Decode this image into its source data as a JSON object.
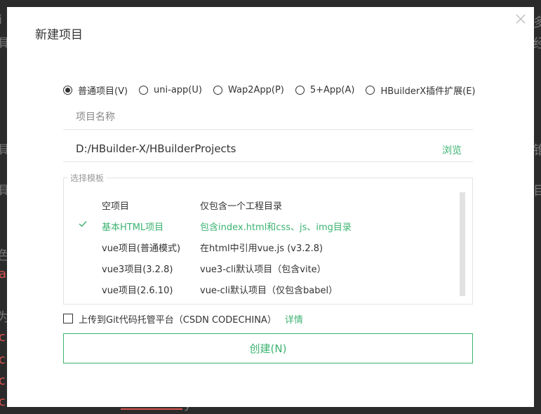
{
  "background": {
    "glyphs_white": [
      "i",
      "具",
      "具",
      "具",
      "色",
      "为"
    ],
    "glyphs_red": [
      "a",
      "c",
      "c",
      "c",
      "c"
    ],
    "right_glyphs": [
      "多",
      "经",
      "锥",
      "目"
    ],
    "bottom_glyph": "y"
  },
  "dialog": {
    "title": "新建项目",
    "close_icon": "close-icon"
  },
  "project_types": [
    {
      "label": "普通项目(V)",
      "checked": true
    },
    {
      "label": "uni-app(U)",
      "checked": false
    },
    {
      "label": "Wap2App(P)",
      "checked": false
    },
    {
      "label": "5+App(A)",
      "checked": false
    },
    {
      "label": "HBuilderX插件扩展(E)",
      "checked": false
    }
  ],
  "project_name": {
    "placeholder": "项目名称",
    "value": ""
  },
  "project_path": {
    "value": "D:/HBuilder-X/HBuilderProjects",
    "browse_label": "浏览"
  },
  "templates": {
    "legend": "选择模板",
    "items": [
      {
        "name": "空项目",
        "desc": "仅包含一个工程目录",
        "selected": false
      },
      {
        "name": "基本HTML项目",
        "desc": "包含index.html和css、js、img目录",
        "selected": true
      },
      {
        "name": "vue项目(普通模式)",
        "desc": "在html中引用vue.js (v3.2.8)",
        "selected": false
      },
      {
        "name": "vue3项目(3.2.8)",
        "desc": "vue3-cli默认项目（包含vite）",
        "selected": false
      },
      {
        "name": "vue项目(2.6.10)",
        "desc": "vue-cli默认项目（仅包含babel）",
        "selected": false
      }
    ]
  },
  "git": {
    "label": "上传到Git代码托管平台（CSDN CODECHINA）",
    "link": "详情",
    "checked": false
  },
  "create_button": {
    "label": "创建(N)"
  },
  "colors": {
    "accent": "#3cb371",
    "backdrop": "#2b2b2b"
  }
}
